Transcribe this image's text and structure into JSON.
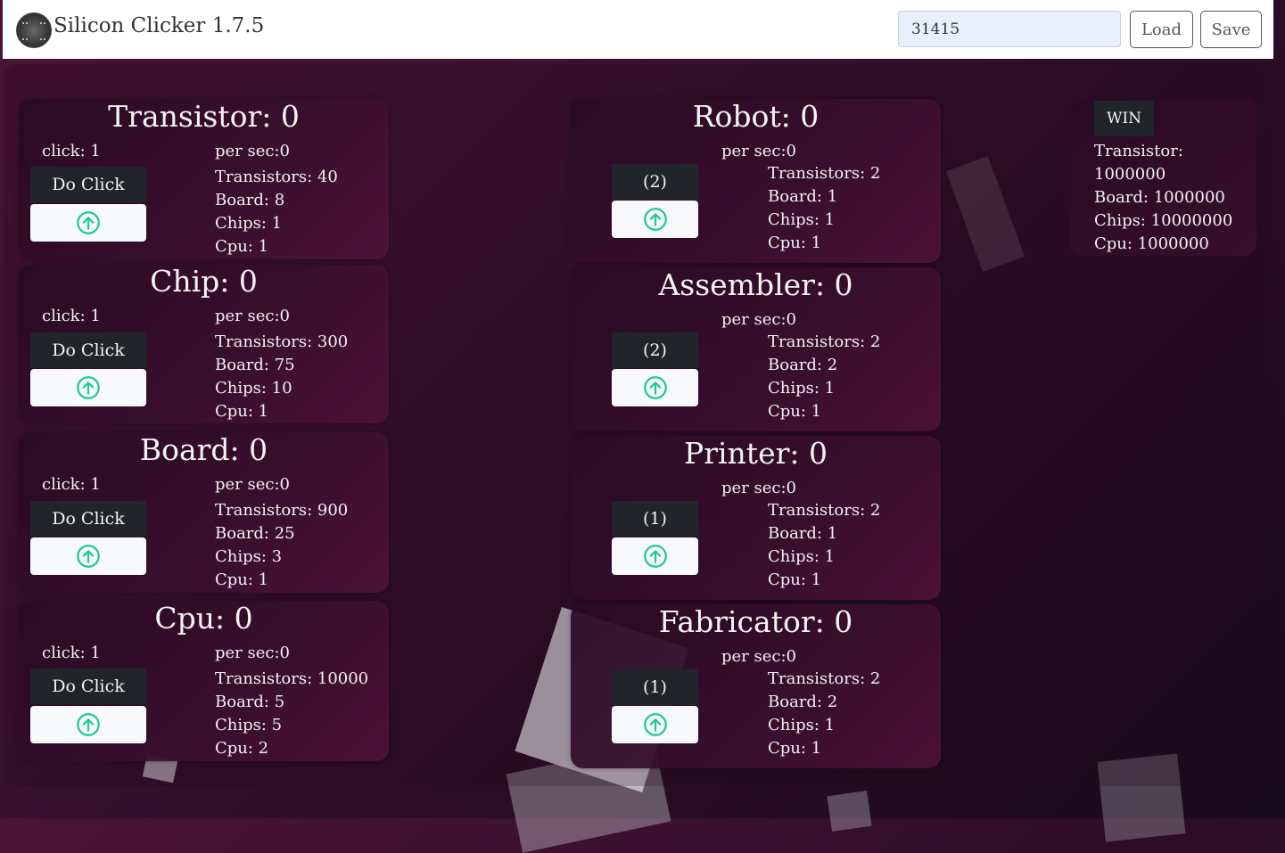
{
  "header": {
    "title": "Silicon Clicker 1.7.5",
    "save_code": "31415",
    "load_label": "Load",
    "save_label": "Save",
    "logo_icon": "chip-logo-icon"
  },
  "left_cards": [
    {
      "title": "Transistor: 0",
      "click": "click: 1",
      "per_sec": "per sec:0",
      "do_click": "Do Click",
      "costs": [
        "Transistors: 40",
        "Board: 8",
        "Chips: 1",
        "Cpu: 1"
      ]
    },
    {
      "title": "Chip: 0",
      "click": "click: 1",
      "per_sec": "per sec:0",
      "do_click": "Do Click",
      "costs": [
        "Transistors: 300",
        "Board: 75",
        "Chips: 10",
        "Cpu: 1"
      ]
    },
    {
      "title": "Board: 0",
      "click": "click: 1",
      "per_sec": "per sec:0",
      "do_click": "Do Click",
      "costs": [
        "Transistors: 900",
        "Board: 25",
        "Chips: 3",
        "Cpu: 1"
      ]
    },
    {
      "title": "Cpu: 0",
      "click": "click: 1",
      "per_sec": "per sec:0",
      "do_click": "Do Click",
      "costs": [
        "Transistors: 10000",
        "Board: 5",
        "Chips: 5",
        "Cpu: 2"
      ]
    }
  ],
  "right_cards": [
    {
      "title": "Robot: 0",
      "per_sec": "per sec:0",
      "count_label": "(2)",
      "costs": [
        "Transistors: 2",
        "Board: 1",
        "Chips: 1",
        "Cpu: 1"
      ]
    },
    {
      "title": "Assembler: 0",
      "per_sec": "per sec:0",
      "count_label": "(2)",
      "costs": [
        "Transistors: 2",
        "Board: 2",
        "Chips: 1",
        "Cpu: 1"
      ]
    },
    {
      "title": "Printer: 0",
      "per_sec": "per sec:0",
      "count_label": "(1)",
      "costs": [
        "Transistors: 2",
        "Board: 1",
        "Chips: 1",
        "Cpu: 1"
      ]
    },
    {
      "title": "Fabricator: 0",
      "per_sec": "per sec:0",
      "count_label": "(1)",
      "costs": [
        "Transistors: 2",
        "Board: 2",
        "Chips: 1",
        "Cpu: 1"
      ]
    }
  ],
  "win": {
    "button": "WIN",
    "lines": [
      "Transistor:",
      "1000000",
      "Board: 1000000",
      "Chips: 10000000",
      "Cpu: 1000000"
    ]
  },
  "colors": {
    "accent_icon": "#20c997",
    "button_dark": "#212529",
    "button_light": "#f8f9fa"
  },
  "icons": {
    "upgrade": "arrow-up-circle-icon"
  }
}
